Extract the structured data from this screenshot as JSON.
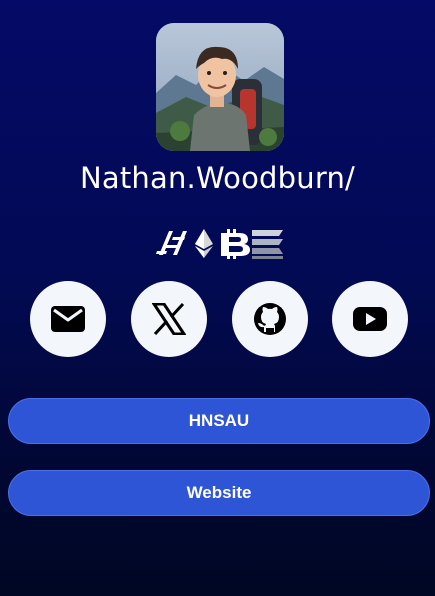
{
  "profile": {
    "name": "Nathan.Woodburn/",
    "avatar_icon": "avatar-photo"
  },
  "logos": [
    "hns-logo-icon",
    "ethereum-icon",
    "bitcoin-icon",
    "stacks-icon"
  ],
  "social": [
    {
      "icon": "envelope-icon",
      "color": "#000000"
    },
    {
      "icon": "x-icon",
      "color": "#000000"
    },
    {
      "icon": "github-icon",
      "color": "#000000"
    },
    {
      "icon": "youtube-icon",
      "color": "#000000"
    }
  ],
  "links": [
    {
      "label": "HNSAU"
    },
    {
      "label": "Website"
    }
  ],
  "colors": {
    "background": "#020a55",
    "button": "#2e55d6",
    "social_bg": "#f3f6fb"
  }
}
